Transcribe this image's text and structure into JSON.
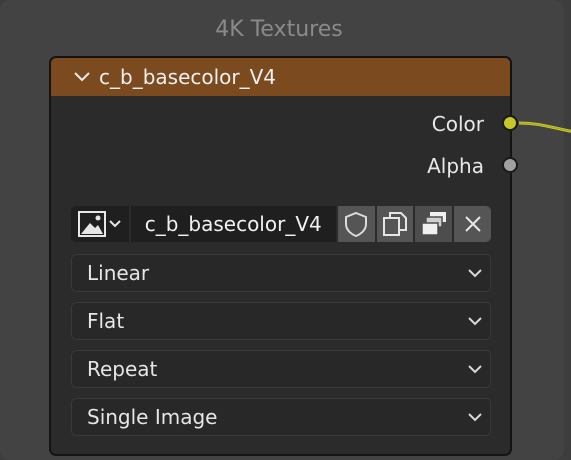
{
  "frame": {
    "title": "4K Textures"
  },
  "node": {
    "title": "c_b_basecolor_V4",
    "header_color": "#7b4a1f",
    "outputs": [
      {
        "label": "Color",
        "socket_color": "#c7c729",
        "connected": true
      },
      {
        "label": "Alpha",
        "socket_color": "#a1a1a1",
        "connected": false
      }
    ],
    "image": {
      "name": "c_b_basecolor_V4",
      "buttons": [
        "fake-user-shield-icon",
        "new-image-icon",
        "open-image-icon",
        "unlink-x-icon"
      ]
    },
    "dropdowns": {
      "interpolation": "Linear",
      "projection": "Flat",
      "extension": "Repeat",
      "source": "Single Image"
    }
  }
}
